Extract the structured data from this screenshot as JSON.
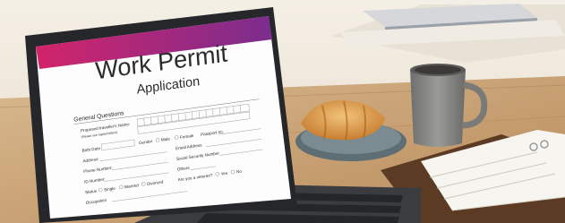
{
  "form": {
    "title": "Work Permit",
    "subtitle": "Application",
    "section": "General Questions",
    "fields": {
      "name": "Proposed traveller's Name:",
      "name_hint": "(Please use capital letters)",
      "birth_date": "Birth Date",
      "gender": "Gender",
      "male": "Male",
      "female": "Female",
      "passport": "Passport no.",
      "address": "Address:",
      "email": "Email Address",
      "phone": "Phone Number:",
      "social": "Social Security Number",
      "id": "ID Number:",
      "status": "Status",
      "single": "Single",
      "married": "Married",
      "divorced": "Divorced",
      "others": "Others",
      "veteran": "Are you a veteran?",
      "yes": "Yes",
      "no": "No",
      "occupation": "Occupation"
    }
  },
  "colors": {
    "header_gradient_start": "#d2246a",
    "header_gradient_end": "#7b2d8e",
    "laptop_body": "#2b2d31",
    "table_wood": "#c9a57a"
  }
}
